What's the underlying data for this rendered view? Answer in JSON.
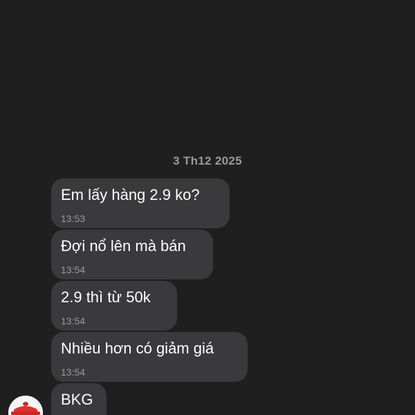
{
  "conversation": {
    "date_separator": "3 Th12 2025",
    "messages": [
      {
        "text": "Em lấy hàng 2.9 ko?",
        "time": "13:53"
      },
      {
        "text": "Đợi nổ lên mà bán",
        "time": "13:54"
      },
      {
        "text": "2.9 thì từ 50k",
        "time": "13:54"
      },
      {
        "text": "Nhiều hơn có giảm giá",
        "time": "13:54"
      },
      {
        "text": "BKG",
        "time": ""
      }
    ]
  },
  "sender": {
    "avatar_icon": "red-pot-avatar-icon"
  },
  "colors": {
    "background": "#1f1f1f",
    "bubble": "#3a3a3c",
    "text": "#ffffff",
    "meta": "#9a9a9a",
    "avatar_accent": "#e0302a"
  }
}
